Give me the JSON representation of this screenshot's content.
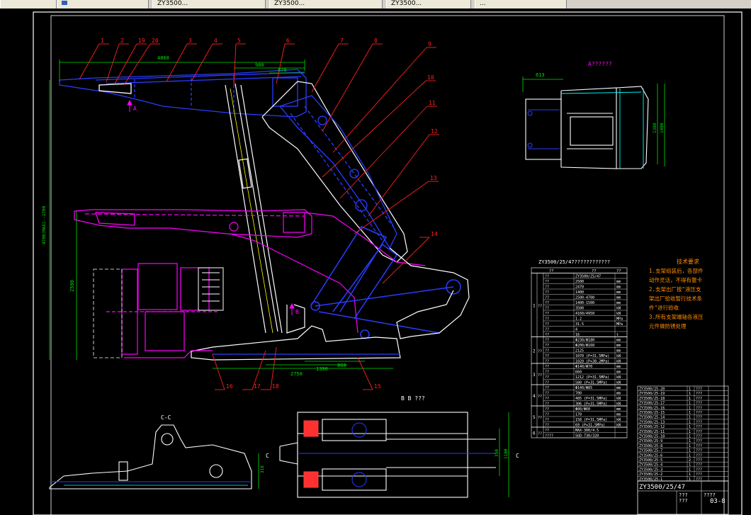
{
  "taskbar": {
    "tabs": [
      {
        "label": ""
      },
      {
        "label": "ZY3500..."
      },
      {
        "label": "ZY3500..."
      },
      {
        "label": "ZY3500..."
      },
      {
        "label": "..."
      }
    ]
  },
  "drawing": {
    "part_numbers": [
      "1",
      "2",
      "19",
      "20",
      "3",
      "4",
      "5",
      "6",
      "7",
      "8",
      "9",
      "10",
      "11",
      "12",
      "13",
      "14",
      "15",
      "16",
      "17",
      "18"
    ],
    "dims_main": {
      "d_top1": "4860",
      "d_top2": "980",
      "d_top3": "870",
      "d_left_height": "4700(MAX)--2700",
      "d_mid": "2590",
      "d_bottom1": "2750",
      "d_bottom2": "1390",
      "d_bottom3": "860"
    },
    "view_a_label": "A??????",
    "view_a_dims": {
      "w": "613",
      "h1": "1380",
      "h2": "1480"
    },
    "arrow_a": "A",
    "arrow_b": "B",
    "view_b_label": "B B ???",
    "view_cc_label": "C-C",
    "view_c_left": "C",
    "view_c_right": "C",
    "view_cc_dim": "316",
    "view_b_dims": {
      "d1": "350",
      "d2": "1100"
    },
    "spec_table": {
      "title": "ZY3500/25/47????????????",
      "header": [
        "??",
        "??",
        "??"
      ],
      "groups": [
        {
          "id": "1",
          "name": "??",
          "rows": [
            [
              "??",
              "ZY3500/25/47",
              ""
            ],
            [
              "??",
              "2500",
              "mm"
            ],
            [
              "??",
              "2470",
              "mm"
            ],
            [
              "??",
              "1400",
              "mm"
            ],
            [
              "??",
              "2500-4700",
              "mm"
            ],
            [
              "??",
              "1400-1500",
              "mm"
            ],
            [
              "??",
              "3500",
              "kN"
            ],
            [
              "??",
              "4160/4950",
              "kN"
            ],
            [
              "??",
              "1.2",
              "MPa"
            ],
            [
              "??",
              "31.5",
              "MPa"
            ],
            [
              "??",
              "4",
              ""
            ],
            [
              "??",
              "16",
              "t"
            ]
          ]
        },
        {
          "id": "2",
          "name": "??",
          "rows": [
            [
              "??",
              "Φ230/Φ180",
              "mm"
            ],
            [
              "??",
              "Φ200/Φ160",
              "mm"
            ],
            [
              "??",
              "2125",
              "mm"
            ],
            [
              "??",
              "1070 (P=31.5MPa)",
              "kN"
            ],
            [
              "??",
              "1020 (P=38.2MPa)",
              "kN"
            ]
          ]
        },
        {
          "id": "3",
          "name": "??",
          "rows": [
            [
              "??",
              "Φ140/Φ70",
              "mm"
            ],
            [
              "??",
              "660",
              "mm"
            ],
            [
              "??",
              "1212 (P=31.5MPa)",
              "kN"
            ],
            [
              "??",
              "580 (P=31.5MPa)",
              "kN"
            ]
          ]
        },
        {
          "id": "4",
          "name": "??",
          "rows": [
            [
              "??",
              "Φ140/Φ85",
              "mm"
            ],
            [
              "??",
              "700",
              "mm"
            ],
            [
              "??",
              "485 (P=31.5MPa)",
              "kN"
            ],
            [
              "??",
              "306 (P=31.5MPa)",
              "kN"
            ]
          ]
        },
        {
          "id": "5",
          "name": "??",
          "rows": [
            [
              "??",
              "Φ80/Φ60",
              "mm"
            ],
            [
              "??",
              "170",
              "mm"
            ],
            [
              "??",
              "158 (P=31.5MPa)",
              "kN"
            ],
            [
              "??",
              "69 (P=31.5MPa)",
              "kN"
            ]
          ]
        },
        {
          "id": "6",
          "name": "??",
          "rows": [
            [
              "??",
              "MAX-300/4.5",
              ""
            ],
            [
              "????",
              "SGD-730/320",
              ""
            ]
          ]
        }
      ]
    },
    "tech_notes": {
      "title": "技术要求",
      "lines": [
        "1.支架组装后，各部件",
        "动作灵活，不得有蹩卡",
        "2.支架出厂按\"液压支",
        "架出厂验收暂行技术条",
        "件\"进行验收",
        "3.所有支架端轴各液压",
        "元件做防锈处理"
      ]
    },
    "title_block": {
      "drawing_title": "ZY3500/25/47",
      "drawing_number": "03-8",
      "q1": "???",
      "q2": "???",
      "q3": "????",
      "parts": [
        {
          "code": "ZY3500/25-20",
          "q": "1",
          "name": "???"
        },
        {
          "code": "ZY3500/25-19",
          "q": "1",
          "name": "???"
        },
        {
          "code": "ZY3500/25-18",
          "q": "1",
          "name": "???"
        },
        {
          "code": "ZY3500/25-17",
          "q": "1",
          "name": "???"
        },
        {
          "code": "ZY3500/25-16",
          "q": "1",
          "name": "???"
        },
        {
          "code": "ZY3500/25-15",
          "q": "1",
          "name": "???"
        },
        {
          "code": "ZY3500/25-14",
          "q": "1",
          "name": "???"
        },
        {
          "code": "ZY3500/25-13",
          "q": "1",
          "name": "???"
        },
        {
          "code": "ZY3500/25-12",
          "q": "1",
          "name": "???"
        },
        {
          "code": "ZY3500/25-11",
          "q": "1",
          "name": "???"
        },
        {
          "code": "ZY3500/25-10",
          "q": "1",
          "name": "???"
        },
        {
          "code": "ZY3500/25-9",
          "q": "1",
          "name": "???"
        },
        {
          "code": "ZY3500/25-8",
          "q": "1",
          "name": "???"
        },
        {
          "code": "ZY3500/25-7",
          "q": "1",
          "name": "???"
        },
        {
          "code": "ZY3500/25-6",
          "q": "1",
          "name": "???"
        },
        {
          "code": "ZY3500/25-5",
          "q": "2",
          "name": "???"
        },
        {
          "code": "ZY3500/25-4",
          "q": "1",
          "name": "???"
        },
        {
          "code": "ZY3500/25-3",
          "q": "1",
          "name": "???"
        },
        {
          "code": "ZY3500/25-2",
          "q": "1",
          "name": "???"
        },
        {
          "code": "ZY3500/25-1",
          "q": "1",
          "name": "???"
        }
      ]
    },
    "colors": {
      "background": "#000000",
      "frame": "#ffffff",
      "leader": "#ff2020",
      "blue": "#2a3cff",
      "magenta": "#ff00ff",
      "white": "#ffffff",
      "green": "#00e000",
      "cyan": "#00ffff",
      "yellow": "#ffff00",
      "orange": "#ff8c00",
      "notes": "#ff8c00"
    }
  }
}
